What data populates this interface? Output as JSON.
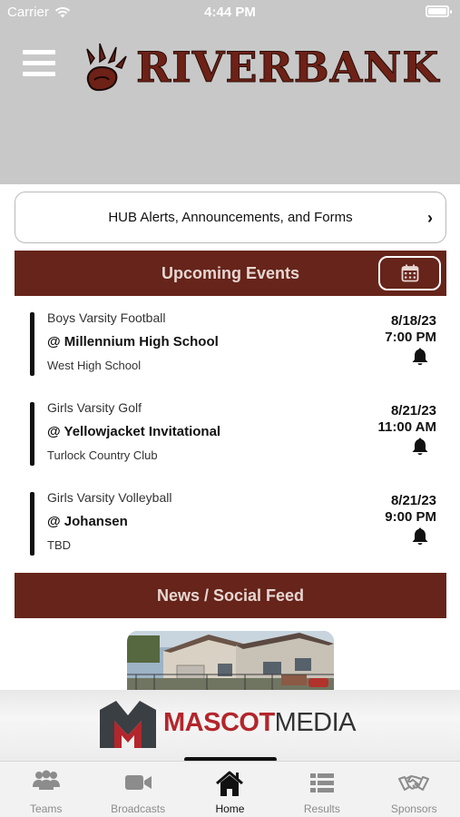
{
  "status_bar": {
    "carrier": "Carrier",
    "time": "4:44 PM"
  },
  "header": {
    "brand": "RIVERBANK",
    "menu_icon": "hamburger-icon",
    "logo_icon": "paw-logo-icon"
  },
  "alerts": {
    "label": "HUB Alerts, Announcements, and Forms",
    "chevron": "›"
  },
  "upcoming": {
    "title": "Upcoming Events",
    "calendar_icon": "calendar-icon",
    "events": [
      {
        "team": "Boys Varsity Football",
        "opponent": "@ Millennium High School",
        "venue": "West High School",
        "date": "8/18/23",
        "time": "7:00 PM"
      },
      {
        "team": "Girls Varsity Golf",
        "opponent": "@ Yellowjacket Invitational",
        "venue": "Turlock Country Club",
        "date": "8/21/23",
        "time": "11:00 AM"
      },
      {
        "team": "Girls Varsity Volleyball",
        "opponent": "@ Johansen",
        "venue": "TBD",
        "date": "8/21/23",
        "time": "9:00 PM"
      }
    ]
  },
  "news": {
    "title": "News / Social Feed"
  },
  "sponsor": {
    "name_part1": "MASCOT",
    "name_part2": "MEDIA"
  },
  "tabs": [
    {
      "label": "Teams",
      "icon": "teams-icon",
      "active": false
    },
    {
      "label": "Broadcasts",
      "icon": "video-camera-icon",
      "active": false
    },
    {
      "label": "Home",
      "icon": "home-icon",
      "active": true
    },
    {
      "label": "Results",
      "icon": "list-icon",
      "active": false
    },
    {
      "label": "Sponsors",
      "icon": "handshake-icon",
      "active": false
    }
  ],
  "colors": {
    "header_bg": "#c8c8c8",
    "accent": "#66241a",
    "bar_text": "#e7d6d2",
    "brand": "#6e2116",
    "sponsor_red": "#b3262b"
  }
}
